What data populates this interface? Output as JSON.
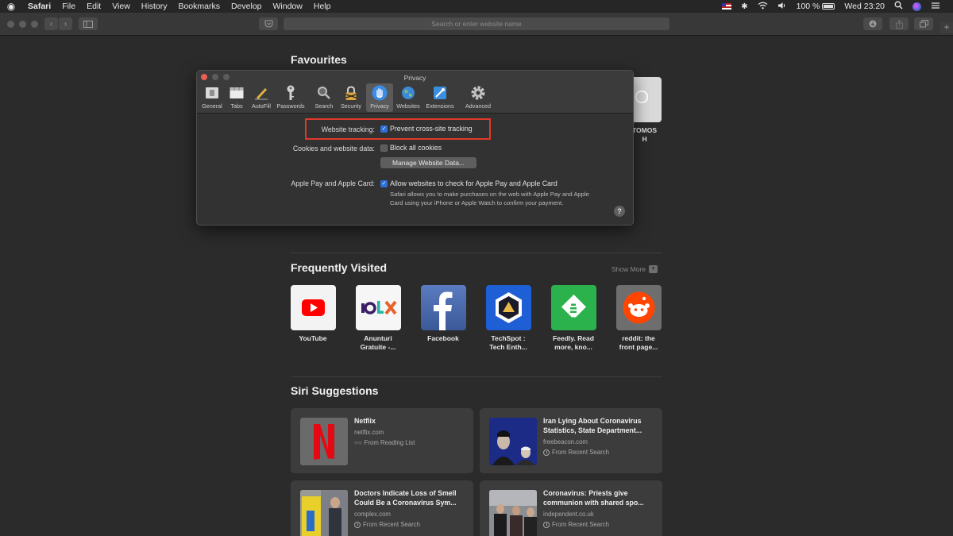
{
  "menubar": {
    "apple": "",
    "items": [
      "Safari",
      "File",
      "Edit",
      "View",
      "History",
      "Bookmarks",
      "Develop",
      "Window",
      "Help"
    ],
    "battery": "100 %",
    "clock": "Wed 23:20"
  },
  "toolbar": {
    "address_placeholder": "Search or enter website name",
    "new_tab": "+"
  },
  "favourites": {
    "title": "Favourites",
    "partial_label_line1": "TOMOS",
    "partial_label_line2": "H"
  },
  "frequently_visited": {
    "title": "Frequently Visited",
    "show_more": "Show More",
    "sites": [
      {
        "label": "YouTube",
        "label2": ""
      },
      {
        "label": "Anunturi",
        "label2": "Gratuite -..."
      },
      {
        "label": "Facebook",
        "label2": ""
      },
      {
        "label": "TechSpot :",
        "label2": "Tech Enth..."
      },
      {
        "label": "Feedly. Read",
        "label2": "more, kno..."
      },
      {
        "label": "reddit: the",
        "label2": "front page..."
      }
    ]
  },
  "siri_suggestions": {
    "title": "Siri Suggestions",
    "cards": [
      {
        "title": "Netflix",
        "domain": "netflix.com",
        "source": "From Reading List"
      },
      {
        "title": "Iran Lying About Coronavirus Statistics, State Department...",
        "domain": "freebeacon.com",
        "source": "From Recent Search"
      },
      {
        "title": "Doctors Indicate Loss of Smell Could Be a Coronavirus Sym...",
        "domain": "complex.com",
        "source": "From Recent Search"
      },
      {
        "title": "Coronavirus: Priests give communion with shared spo...",
        "domain": "independent.co.uk",
        "source": "From Recent Search"
      }
    ]
  },
  "privacy_dialog": {
    "title": "Privacy",
    "panes": [
      "General",
      "Tabs",
      "AutoFill",
      "Passwords",
      "Search",
      "Security",
      "Privacy",
      "Websites",
      "Extensions",
      "Advanced"
    ],
    "selected_pane": "Privacy",
    "website_tracking_label": "Website tracking:",
    "prevent_tracking": "Prevent cross-site tracking",
    "prevent_tracking_checked": true,
    "cookies_label": "Cookies and website data:",
    "block_cookies": "Block all cookies",
    "block_cookies_checked": false,
    "manage_button": "Manage Website Data...",
    "apple_pay_label": "Apple Pay and Apple Card:",
    "apple_pay_option": "Allow websites to check for Apple Pay and Apple Card",
    "apple_pay_checked": true,
    "apple_pay_desc": "Safari allows you to make purchases on the web with Apple Pay and Apple Card using your iPhone or Apple Watch to confirm your payment.",
    "help": "?"
  },
  "colors": {
    "highlight": "#e0392b",
    "checkbox": "#2d6fd6",
    "youtube": "#ff0000",
    "facebook": "#3b5998",
    "feedly": "#2bb24c",
    "reddit": "#ff4500",
    "netflix": "#e50914"
  }
}
